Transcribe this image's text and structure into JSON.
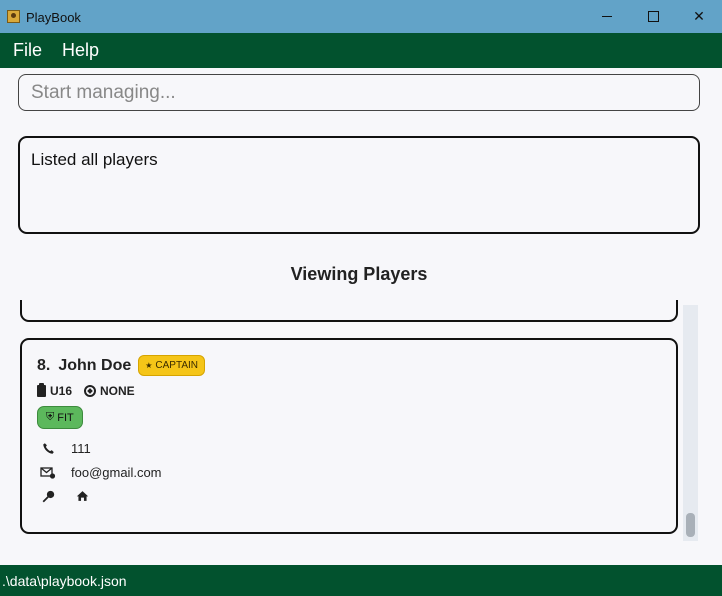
{
  "window": {
    "title": "PlayBook",
    "minimize_icon": "minimize-icon",
    "maximize_icon": "maximize-icon",
    "close_icon": "close-icon",
    "close_glyph": "✕"
  },
  "menu": {
    "items": [
      "File",
      "Help"
    ]
  },
  "command": {
    "placeholder": "Start managing..."
  },
  "result": {
    "message": "Listed all players"
  },
  "list": {
    "title": "Viewing Players"
  },
  "player": {
    "index": "8.",
    "name": "John Doe",
    "captain_badge": "CAPTAIN",
    "age_group": "U16",
    "position": "NONE",
    "fitness": "FIT",
    "phone": "111",
    "email": "foo@gmail.com",
    "address": ""
  },
  "icons": {
    "star": "★",
    "shield": "⛨",
    "phone": "📞",
    "email": "✉",
    "pin": "⚲",
    "home": "⌂"
  },
  "colors": {
    "title_bar": "#62a3c8",
    "menu_bar": "#02522e",
    "status_bar": "#02522e",
    "captain_badge": "#f5c518",
    "fit_badge": "#5cb85c"
  },
  "status": {
    "path": ".\\data\\playbook.json"
  }
}
